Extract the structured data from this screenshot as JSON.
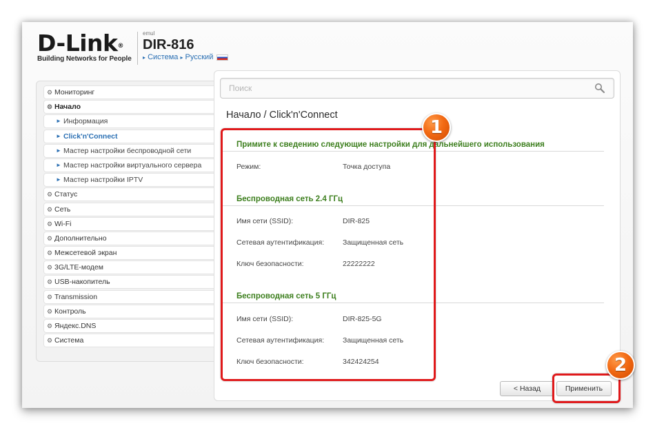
{
  "header": {
    "logo_text": "D-Link",
    "logo_registered": "®",
    "logo_tagline": "Building Networks for People",
    "model_prefix": "emul",
    "model_name": "DIR-816",
    "link_system": "Система",
    "link_language": "Русский"
  },
  "sidebar": {
    "items": [
      {
        "label": "Мониторинг",
        "icon": "gear-icon"
      },
      {
        "label": "Начало",
        "icon": "gear-icon",
        "expanded": true
      },
      {
        "label": "Информация",
        "icon": "arrow-right-icon"
      },
      {
        "label": "Click'n'Connect",
        "icon": "arrow-right-icon",
        "active": true
      },
      {
        "label": "Мастер настройки беспроводной сети",
        "icon": "arrow-right-icon"
      },
      {
        "label": "Мастер настройки виртуального сервера",
        "icon": "arrow-right-icon"
      },
      {
        "label": "Мастер настройки IPTV",
        "icon": "arrow-right-icon"
      },
      {
        "label": "Статус",
        "icon": "gear-icon"
      },
      {
        "label": "Сеть",
        "icon": "gear-icon"
      },
      {
        "label": "Wi-Fi",
        "icon": "gear-icon"
      },
      {
        "label": "Дополнительно",
        "icon": "gear-icon"
      },
      {
        "label": "Межсетевой экран",
        "icon": "gear-icon"
      },
      {
        "label": "3G/LTE-модем",
        "icon": "gear-icon"
      },
      {
        "label": "USB-накопитель",
        "icon": "gear-icon"
      },
      {
        "label": "Transmission",
        "icon": "gear-icon"
      },
      {
        "label": "Контроль",
        "icon": "gear-icon"
      },
      {
        "label": "Яндекс.DNS",
        "icon": "gear-icon"
      },
      {
        "label": "Система",
        "icon": "gear-icon"
      }
    ]
  },
  "search": {
    "placeholder": "Поиск"
  },
  "breadcrumb": {
    "parent": "Начало /",
    "current": "Click'n'Connect"
  },
  "summary": {
    "title": "Примите к сведению следующие настройки для дальнейшего использования",
    "mode_label": "Режим:",
    "mode_value": "Точка доступа"
  },
  "wifi24": {
    "title": "Беспроводная сеть 2.4 ГГц",
    "ssid_label": "Имя сети (SSID):",
    "ssid_value": "DIR-825",
    "auth_label": "Сетевая аутентификация:",
    "auth_value": "Защищенная сеть",
    "key_label": "Ключ безопасности:",
    "key_value": "22222222"
  },
  "wifi5": {
    "title": "Беспроводная сеть 5 ГГц",
    "ssid_label": "Имя сети (SSID):",
    "ssid_value": "DIR-825-5G",
    "auth_label": "Сетевая аутентификация:",
    "auth_value": "Защищенная сеть",
    "key_label": "Ключ безопасности:",
    "key_value": "342424254"
  },
  "buttons": {
    "back": "< Назад",
    "apply": "Применить"
  },
  "annotations": {
    "badge1": "1",
    "badge2": "2"
  },
  "colors": {
    "accent_blue": "#2a6fb3",
    "section_green": "#3d7f1e",
    "highlight_red": "#e0191b",
    "badge_orange": "#f26a14"
  }
}
